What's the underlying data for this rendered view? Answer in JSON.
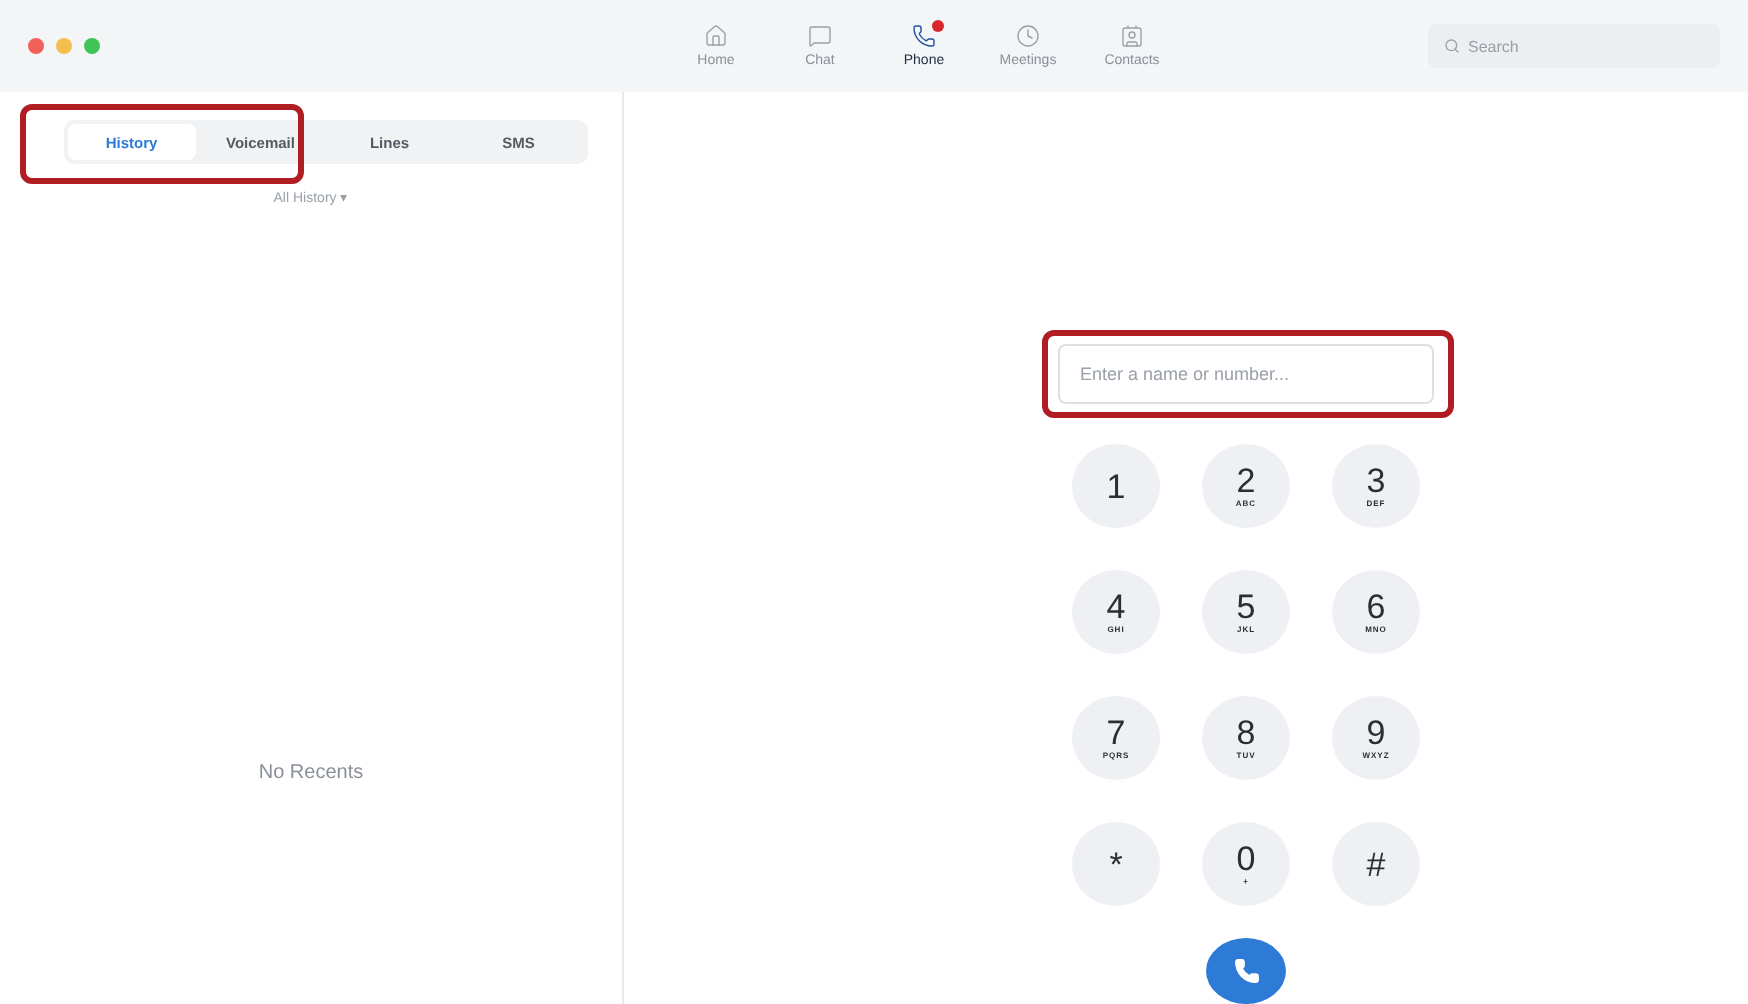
{
  "nav": [
    {
      "label": "Home",
      "kind": "home",
      "selected": false,
      "badge": false
    },
    {
      "label": "Chat",
      "kind": "chat",
      "selected": false,
      "badge": false
    },
    {
      "label": "Phone",
      "kind": "phone",
      "selected": true,
      "badge": true
    },
    {
      "label": "Meetings",
      "kind": "clock",
      "selected": false,
      "badge": false
    },
    {
      "label": "Contacts",
      "kind": "contacts",
      "selected": false,
      "badge": false
    }
  ],
  "search": {
    "placeholder": "Search"
  },
  "sidebar": {
    "highlighted": true,
    "tabs": [
      {
        "label": "History",
        "selected": true
      },
      {
        "label": "Voicemail",
        "selected": false
      },
      {
        "label": "Lines",
        "selected": false
      },
      {
        "label": "SMS",
        "selected": false
      }
    ],
    "filter": "All History ▾",
    "empty_text": "No Recents"
  },
  "dialer": {
    "field": {
      "placeholder": "Enter a name or number...",
      "highlighted": true
    },
    "keys": [
      {
        "digit": "1"
      },
      {
        "digit": "2",
        "letters": "ABC"
      },
      {
        "digit": "3",
        "letters": "DEF"
      },
      {
        "digit": "4",
        "letters": "GHI"
      },
      {
        "digit": "5",
        "letters": "JKL"
      },
      {
        "digit": "6",
        "letters": "MNO"
      },
      {
        "digit": "7",
        "letters": "PQRS"
      },
      {
        "digit": "8",
        "letters": "TUV"
      },
      {
        "digit": "9",
        "letters": "WXYZ"
      },
      {
        "digit": "*"
      },
      {
        "digit": "0",
        "letters": "+"
      },
      {
        "digit": "#"
      }
    ]
  }
}
